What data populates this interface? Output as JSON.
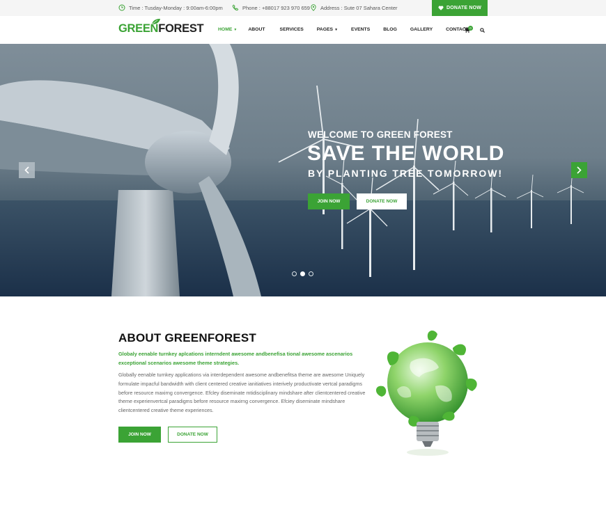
{
  "topbar": {
    "time_label": "Time :  Tusday-Monday : 9:00am-6:00pm",
    "phone_label": "Phone : +88017 923 970 659",
    "address_label": "Address :  Sute 07 Sahara Center",
    "donate_label": "DONATE NOW"
  },
  "header": {
    "logo_green": "GREEN",
    "logo_dark": "FOREST",
    "nav": [
      {
        "label": "HOME",
        "dropdown": true,
        "active": true
      },
      {
        "label": "ABOUT"
      },
      {
        "label": "SERVICES"
      },
      {
        "label": "PAGES",
        "dropdown": true
      },
      {
        "label": "EVENTS"
      },
      {
        "label": "BLOG"
      },
      {
        "label": "GALLERY"
      },
      {
        "label": "CONTACT"
      }
    ],
    "cart_count": "0"
  },
  "hero": {
    "subtitle": "WELCOME TO GREEN FOREST",
    "title": "SAVE THE WORLD",
    "tagline": "BY PLANTING TREE TOMORROW!",
    "join_label": "JOIN NOW",
    "donate_label": "DONATE NOW",
    "slide_count": 3,
    "active_slide": 2
  },
  "about": {
    "title": "ABOUT GREENFOREST",
    "lead": "Globaly eenable turnkey aplcations interndent awesome andbenefisa tional awesome ascenarios exceptional scenarios awesome theme strategies.",
    "body": "Globally eenable turnkey applications via interdependent awesome andbenefitsa theme are awesome Uniquely formulate impacful bandwidth with client centered creative ianitiatives interively productivate vertcal paradigms before resource maxirng convergence. Efcley diseminate mtidisciplinary mindshare after clientcentered creative theme experienvertcal paradigms before resource maxirng convergence. Efciey diseminate mindshare clientcentered creative theme experiences.",
    "join_label": "JOIN NOW",
    "donate_label": "DONATE NOW"
  },
  "colors": {
    "brand_green": "#3ba335"
  }
}
